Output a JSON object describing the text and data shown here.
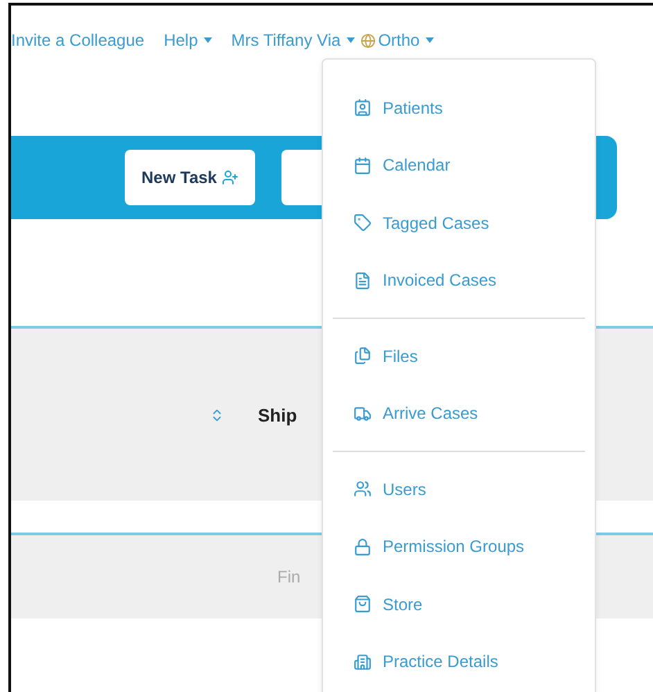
{
  "top_nav": {
    "links": [
      {
        "label": "Invite a Colleague",
        "dropdown": false
      },
      {
        "label": "Help",
        "dropdown": true
      },
      {
        "label": "Mrs Tiffany Via",
        "dropdown": true
      }
    ],
    "practice": {
      "label": "Ortho",
      "dropdown": true
    }
  },
  "toolbar": {
    "buttons": [
      "New Task"
    ]
  },
  "table": {
    "columns": [
      {
        "label": "Ship",
        "sortable": true
      }
    ],
    "filter": {
      "placeholder": "Fin"
    }
  },
  "menu": {
    "groups": [
      [
        {
          "label": "Patients"
        },
        {
          "label": "Calendar"
        },
        {
          "label": "Tagged Cases"
        },
        {
          "label": "Invoiced Cases"
        }
      ],
      [
        {
          "label": "Files"
        },
        {
          "label": "Arrive Cases"
        }
      ],
      [
        {
          "label": "Users"
        },
        {
          "label": "Permission Groups"
        },
        {
          "label": "Store"
        },
        {
          "label": "Practice Details"
        }
      ]
    ]
  }
}
